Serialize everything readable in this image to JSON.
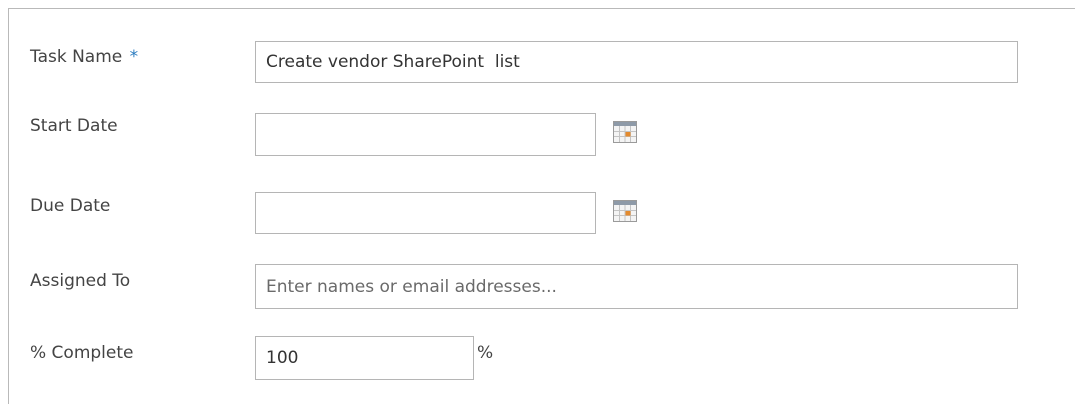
{
  "form": {
    "task_name": {
      "label": "Task Name",
      "required_marker": "*",
      "value": "Create vendor SharePoint  list"
    },
    "start_date": {
      "label": "Start Date",
      "value": "",
      "calendar_icon": "calendar-icon"
    },
    "due_date": {
      "label": "Due Date",
      "value": "",
      "calendar_icon": "calendar-icon"
    },
    "assigned_to": {
      "label": "Assigned To",
      "value": "",
      "placeholder": "Enter names or email addresses..."
    },
    "percent_complete": {
      "label": "% Complete",
      "value": "100",
      "unit": "%"
    }
  },
  "colors": {
    "required_marker": "#2a7bbf",
    "border": "#b5b5b5",
    "label_text": "#444444"
  }
}
